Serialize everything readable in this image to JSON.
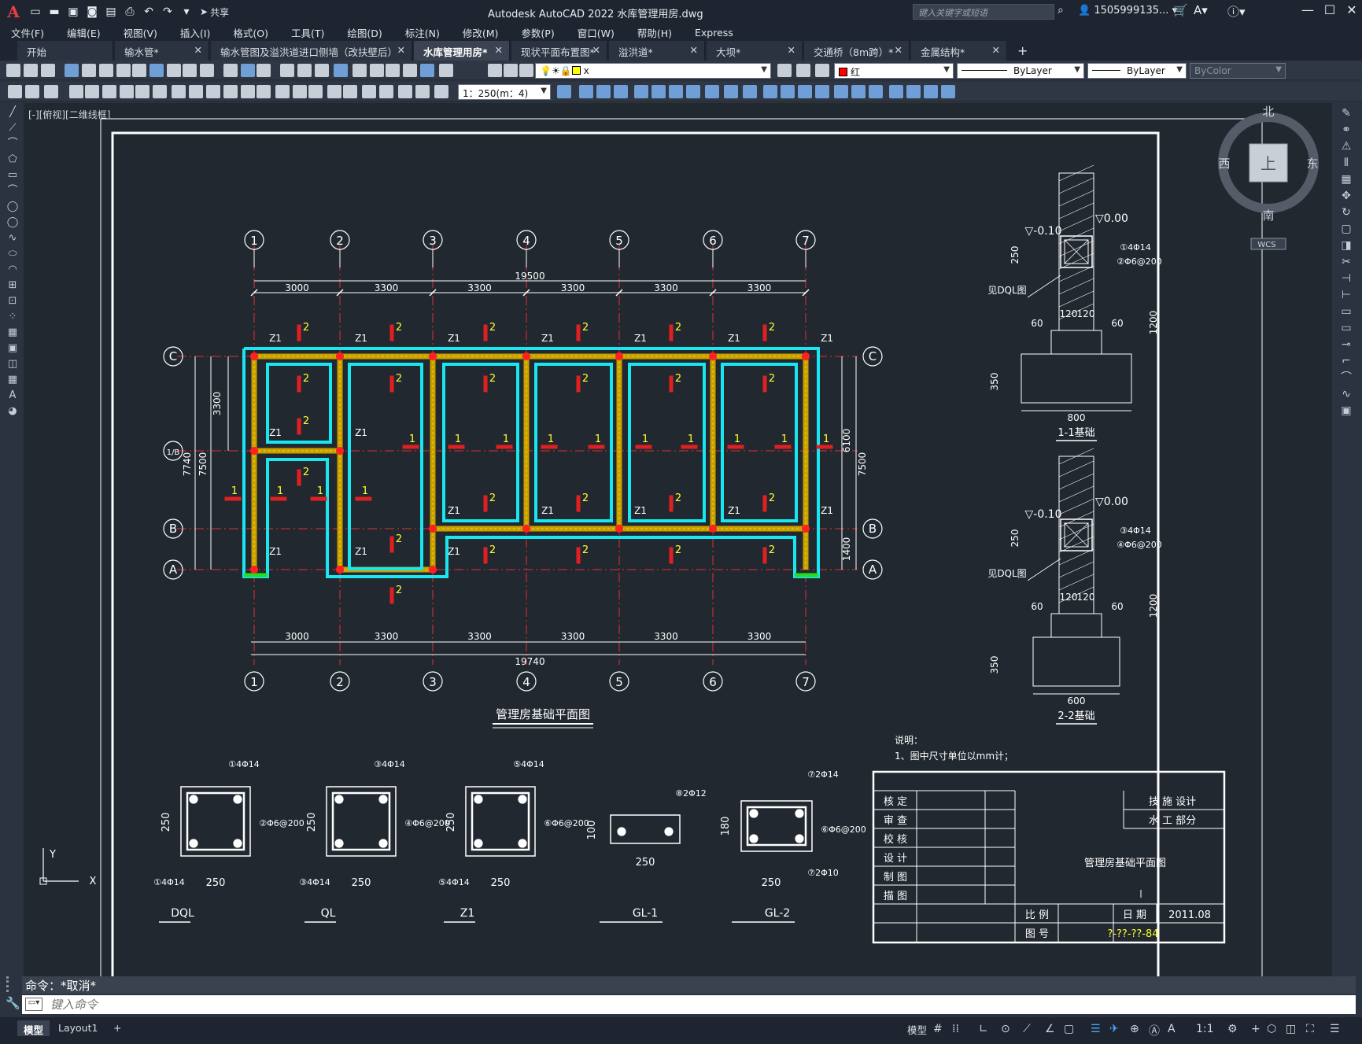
{
  "titlebar": {
    "logo": "A",
    "share_label": "共享",
    "title": "Autodesk AutoCAD 2022    水库管理用房.dwg",
    "search_placeholder": "键入关键字或短语",
    "user": "1505999135...",
    "help": "?"
  },
  "menu": [
    "文件(F)",
    "编辑(E)",
    "视图(V)",
    "插入(I)",
    "格式(O)",
    "工具(T)",
    "绘图(D)",
    "标注(N)",
    "修改(M)",
    "参数(P)",
    "窗口(W)",
    "帮助(H)",
    "Express"
  ],
  "tabs": [
    {
      "label": "开始",
      "closable": false
    },
    {
      "label": "输水管*",
      "closable": true
    },
    {
      "label": "输水管图及溢洪道进口侧墙（改扶壁后）",
      "closable": true
    },
    {
      "label": "水库管理用房*",
      "closable": true,
      "active": true
    },
    {
      "label": "现状平面布置图*",
      "closable": true
    },
    {
      "label": "溢洪道*",
      "closable": true
    },
    {
      "label": "大坝*",
      "closable": true
    },
    {
      "label": "交通桥（8m跨）*",
      "closable": true
    },
    {
      "label": "金属结构*",
      "closable": true
    }
  ],
  "tab_close": "✕",
  "tab_add": "+",
  "properties": {
    "layer": "x",
    "color": "红",
    "color_hex": "#ff0000",
    "linetype": "ByLayer",
    "lineweight": "ByLayer",
    "plotstyle": "ByColor",
    "scale": "1：250(m：4)"
  },
  "viewport_label": "[-][俯视][二维线框]",
  "viewcube": {
    "north": "北",
    "south": "南",
    "east": "东",
    "west": "西",
    "face": "上",
    "wcs": "WCS"
  },
  "drawing": {
    "axis_numbers": [
      "1",
      "2",
      "3",
      "4",
      "5",
      "6",
      "7"
    ],
    "axis_letters": [
      "C",
      "1/B",
      "B",
      "A"
    ],
    "top_dims": [
      "3000",
      "3300",
      "3300",
      "3300",
      "3300",
      "3300"
    ],
    "top_total": "19500",
    "bottom_dims": [
      "3000",
      "3300",
      "3300",
      "3300",
      "3300",
      "3300"
    ],
    "bottom_total": "19740",
    "left_dims": [
      "3300",
      "7500",
      "7740"
    ],
    "right_dims": [
      "6100",
      "7500",
      "1400"
    ],
    "column_label": "Z1",
    "section_marks": [
      "1",
      "2"
    ],
    "plan_title": "管理房基础平面图",
    "section1": {
      "title": "1-1基础",
      "elev_top": "▽0.00",
      "elev_mid": "▽-0.10",
      "dim_250": "250",
      "dim_1200": "1200",
      "dim_350": "350",
      "dim_60": "60",
      "dim_120": "120",
      "dim_width": "800",
      "rebar1": "①4Φ14",
      "rebar2": "②Φ6@200",
      "ref": "见DQL图"
    },
    "section2": {
      "title": "2-2基础",
      "elev_top": "▽0.00",
      "elev_mid": "▽-0.10",
      "dim_250": "250",
      "dim_1200": "1200",
      "dim_350": "350",
      "dim_60": "60",
      "dim_120": "120",
      "dim_width": "600",
      "rebar1": "③4Φ14",
      "rebar2": "④Φ6@200",
      "ref": "见DQL图"
    },
    "notes_title": "说明：",
    "notes_1": "1、图中尺寸单位以mm计；",
    "beams": [
      {
        "name": "DQL",
        "top_rebar": "①4Φ14",
        "bot_rebar": "①4Φ14",
        "stirrup": "②Φ6@200",
        "w": "250",
        "h": "250"
      },
      {
        "name": "QL",
        "top_rebar": "③4Φ14",
        "bot_rebar": "③4Φ14",
        "stirrup": "④Φ6@200",
        "w": "250",
        "h": "250"
      },
      {
        "name": "Z1",
        "top_rebar": "⑤4Φ14",
        "bot_rebar": "⑤4Φ14",
        "stirrup": "⑥Φ6@200",
        "w": "250",
        "h": "250"
      },
      {
        "name": "GL-1",
        "top_rebar": "⑧2Φ12",
        "w": "250",
        "h": "100"
      },
      {
        "name": "GL-2",
        "top_rebar": "⑦2Φ14",
        "bot_rebar": "⑦2Φ10",
        "stirrup": "⑥Φ6@200",
        "w": "250",
        "h": "180"
      }
    ],
    "titleblock": {
      "rows": [
        "核  定",
        "审  查",
        "校  核",
        "设  计",
        "制  图",
        "描  图"
      ],
      "company1": "技  施  设计",
      "company2": "水  工  部分",
      "drawing_name": "管理房基础平面图",
      "scale_label": "比  例",
      "date_label": "日  期",
      "date": "2011.08",
      "number_label": "图  号",
      "number": "?-??-??-84"
    },
    "ucs_y": "Y",
    "ucs_x": "X"
  },
  "command": {
    "history": "命令：*取消*",
    "placeholder": "键入命令"
  },
  "status": {
    "model": "模型",
    "layout1": "Layout1",
    "add": "+",
    "model_btn": "模型",
    "scale": "1:1"
  }
}
